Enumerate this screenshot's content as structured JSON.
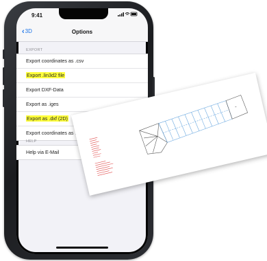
{
  "status_bar": {
    "time": "9:41",
    "icons": "signal-wifi-battery"
  },
  "nav": {
    "back_label": "3D",
    "title": "Options"
  },
  "sections": [
    {
      "header": "EXPORT",
      "items": [
        {
          "label": "Export coordinates as .csv",
          "highlighted": false
        },
        {
          "label": "Export .lin3d2 file",
          "highlighted": true
        },
        {
          "label": "Export DXF-Data",
          "highlighted": false
        },
        {
          "label": "Export as .iges",
          "highlighted": false
        },
        {
          "label": "Export as .dxf (2D)",
          "highlighted": true
        },
        {
          "label": "Export coordinates as .obj",
          "highlighted": false
        }
      ]
    },
    {
      "header": "HELP",
      "items": [
        {
          "label": "Help via E-Mail",
          "highlighted": false
        }
      ]
    }
  ],
  "colors": {
    "highlight": "#ffff3b",
    "accent": "#1a73e8",
    "drawing_blue": "#6aa8e0",
    "drawing_red": "#e04848"
  },
  "drawing": {
    "description_hidden": true
  }
}
